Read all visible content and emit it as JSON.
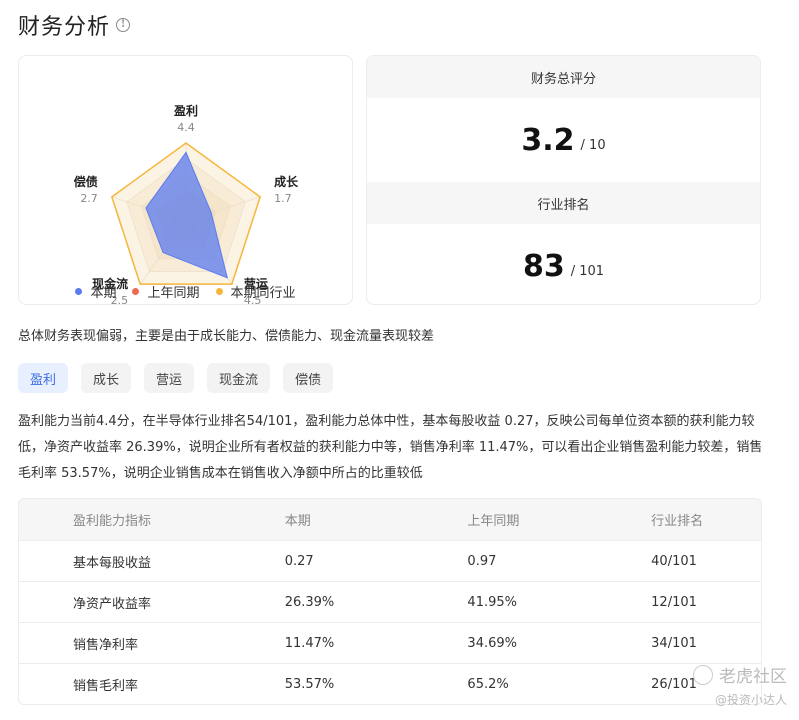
{
  "header": {
    "title": "财务分析",
    "info_icon": "info-circle-icon"
  },
  "radar": {
    "axes": [
      {
        "name": "盈利",
        "value": "4.4"
      },
      {
        "name": "成长",
        "value": "1.7"
      },
      {
        "name": "营运",
        "value": "4.5"
      },
      {
        "name": "现金流",
        "value": "2.5"
      },
      {
        "name": "偿债",
        "value": "2.7"
      }
    ],
    "current": [
      4.4,
      1.7,
      4.5,
      2.5,
      2.7
    ],
    "industry": [
      5,
      5,
      5,
      5,
      5
    ],
    "max": 5,
    "legend": [
      {
        "label": "本期",
        "color": "#5b7bf0"
      },
      {
        "label": "上年同期",
        "color": "#ee6b51"
      },
      {
        "label": "本期同行业",
        "color": "#f5b63a"
      }
    ]
  },
  "score": {
    "total_label": "财务总评分",
    "total_value": "3.2",
    "total_max": "/ 10",
    "rank_label": "行业排名",
    "rank_value": "83",
    "rank_total": "/ 101"
  },
  "summary": "总体财务表现偏弱，主要是由于成长能力、偿债能力、现金流量表现较差",
  "tabs": [
    "盈利",
    "成长",
    "营运",
    "现金流",
    "偿债"
  ],
  "description": "盈利能力当前4.4分，在半导体行业排名54/101，盈利能力总体中性，基本每股收益 0.27，反映公司每单位资本额的获利能力较低，净资产收益率 26.39%，说明企业所有者权益的获利能力中等，销售净利率 11.47%，可以看出企业销售盈利能力较差，销售毛利率 53.57%，说明企业销售成本在销售收入净额中所占的比重较低",
  "table": {
    "headers": [
      "盈利能力指标",
      "本期",
      "上年同期",
      "行业排名"
    ],
    "rows": [
      [
        "基本每股收益",
        "0.27",
        "0.97",
        "40/101"
      ],
      [
        "净资产收益率",
        "26.39%",
        "41.95%",
        "12/101"
      ],
      [
        "销售净利率",
        "11.47%",
        "34.69%",
        "34/101"
      ],
      [
        "销售毛利率",
        "53.57%",
        "65.2%",
        "26/101"
      ]
    ]
  },
  "watermark": {
    "line1": "老虎社区",
    "line2": "@投资小达人"
  }
}
